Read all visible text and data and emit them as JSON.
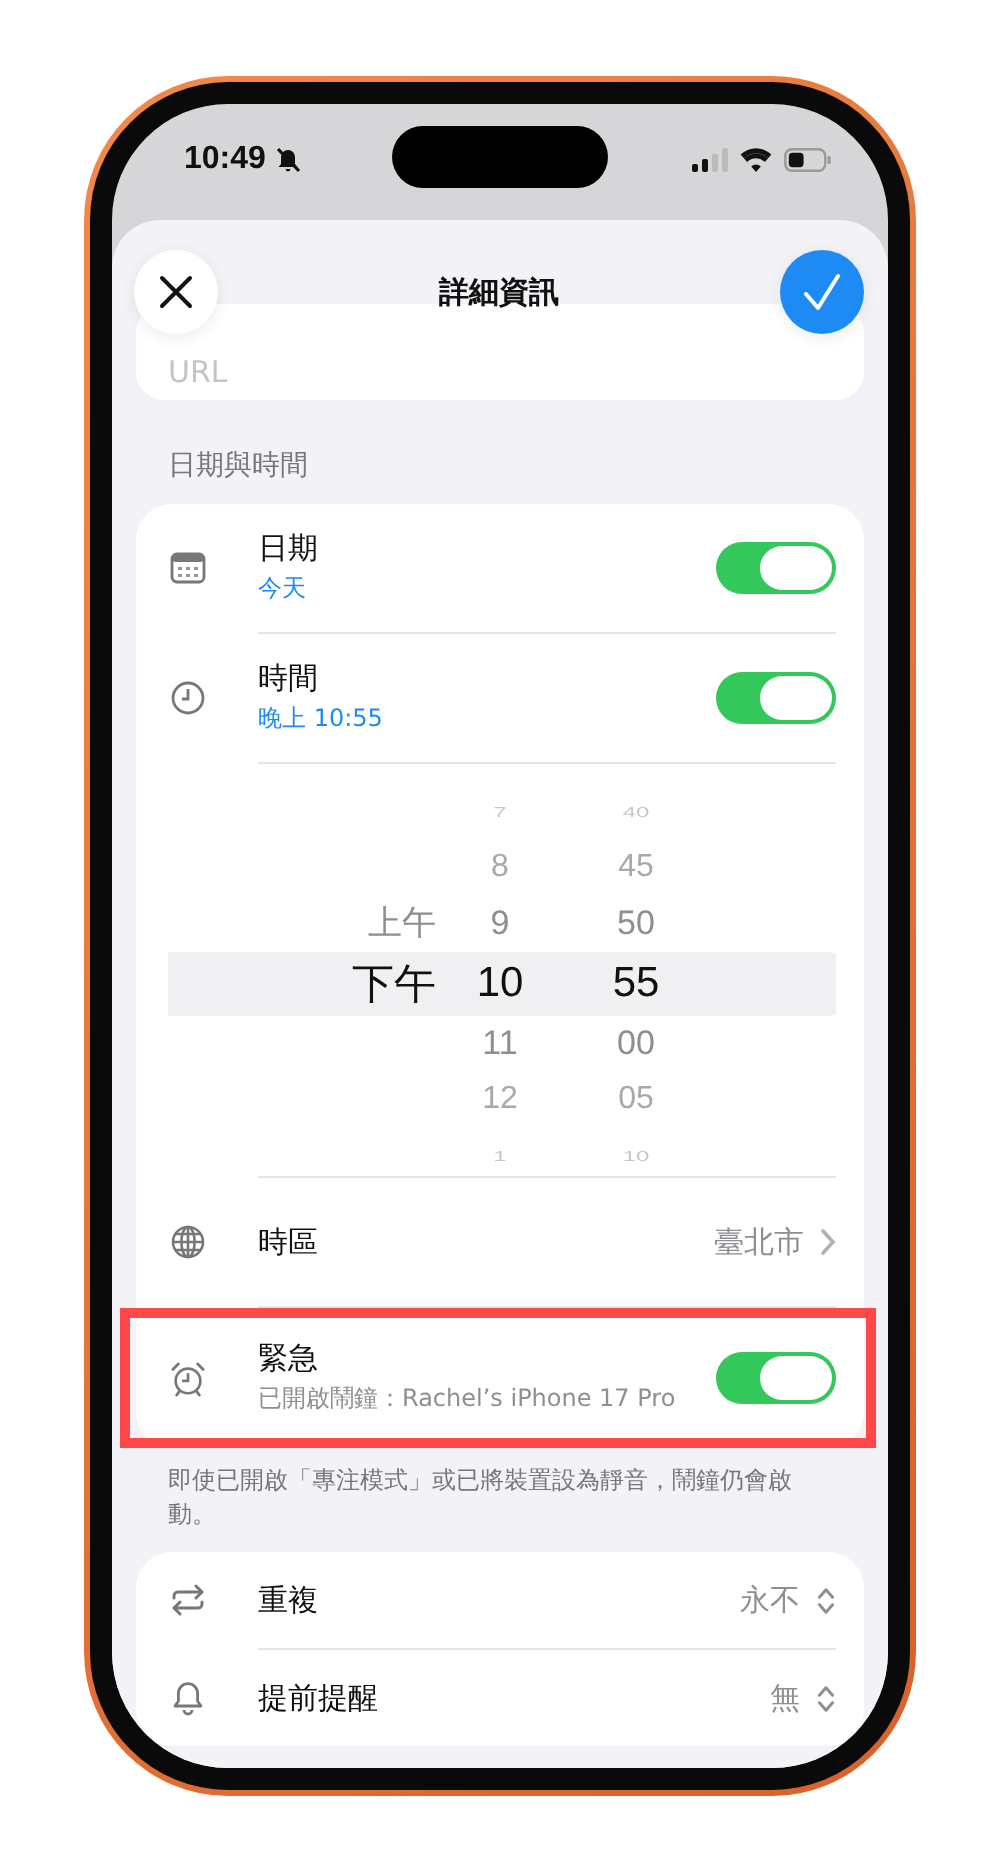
{
  "status_bar": {
    "time": "10:49"
  },
  "header": {
    "title": "詳細資訊"
  },
  "url_field": {
    "placeholder": "URL"
  },
  "date_time_section": {
    "heading": "日期與時間",
    "rows": [
      {
        "kind": "toggle",
        "label": "日期",
        "detail": "今天",
        "on": true,
        "highlighted": false
      },
      {
        "kind": "toggle",
        "label": "時間",
        "detail": "晚上 10:55",
        "on": true,
        "highlighted": false
      },
      {
        "kind": "picker",
        "columns": [
          {
            "items": [
              {
                "text": "上午",
                "selected": false
              },
              {
                "text": "下午",
                "selected": true
              }
            ]
          },
          {
            "items": [
              {
                "text": "7",
                "selected": false
              },
              {
                "text": "8",
                "selected": false
              },
              {
                "text": "9",
                "selected": false
              },
              {
                "text": "10",
                "selected": true
              },
              {
                "text": "11",
                "selected": false
              },
              {
                "text": "12",
                "selected": false
              },
              {
                "text": "1",
                "selected": false
              }
            ]
          },
          {
            "items": [
              {
                "text": "40",
                "selected": false
              },
              {
                "text": "45",
                "selected": false
              },
              {
                "text": "50",
                "selected": false
              },
              {
                "text": "55",
                "selected": true
              },
              {
                "text": "00",
                "selected": false
              },
              {
                "text": "05",
                "selected": false
              },
              {
                "text": "10",
                "selected": false
              }
            ]
          }
        ]
      },
      {
        "kind": "link",
        "label": "時區",
        "value": "臺北市",
        "highlighted": false
      },
      {
        "kind": "toggle",
        "label": "緊急",
        "detail": "已開啟鬧鐘：Rachel’s iPhone 17 Pro",
        "on": true,
        "highlighted": true
      }
    ],
    "footnote": "即使已開啟「專注模式」或已將裝置設為靜音，鬧鐘仍會啟動。"
  },
  "options_section": {
    "rows": [
      {
        "kind": "popup",
        "label": "重複",
        "value": "永不"
      },
      {
        "kind": "popup",
        "label": "提前提醒",
        "value": "無"
      }
    ]
  }
}
